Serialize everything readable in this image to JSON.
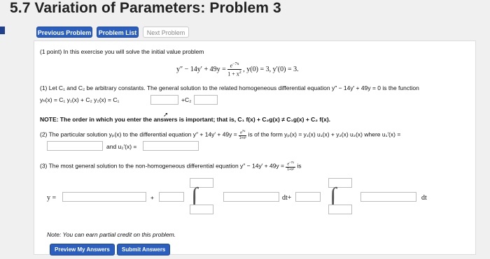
{
  "page": {
    "title": "5.7 Variation of Parameters: Problem 3"
  },
  "nav": {
    "previous": "Previous Problem",
    "list": "Problem List",
    "next": "Next Problem"
  },
  "intro": "(1 point) In this exercise you will solve the initial value problem",
  "ivp": {
    "lhs": "y″ − 14y′ + 49y =",
    "num": "e",
    "num_exp": "−7x",
    "den": "1 + x",
    "den_exp": "2",
    "ics": ",  y(0) = 3,  y′(0) = 3."
  },
  "part1": {
    "line1": "(1) Let C₁ and C₂ be arbitrary constants. The general solution to the related homogeneous differential equation y″ − 14y′ + 49y = 0 is the function",
    "line2_prefix": "yₕ(x) = C₁ y₁(x) + C₂ y₂(x) = C₁",
    "plus_c2": "+C₂"
  },
  "note_order": "NOTE: The order in which you enter the answers is important; that is, C₁ f(x) + C₂g(x) ≠ C₁g(x) + C₂ f(x).",
  "part2": {
    "line1_a": "(2) The particular solution yₚ(x) to the differential equation y″ + 14y′ + 49y =",
    "frac_num": "e",
    "frac_num_exp": "7x",
    "frac_den": "1+x²",
    "line1_b": "is of the form yₚ(x) = y₁(x) u₁(x) + y₂(x) u₂(x) where u₁′(x) =",
    "and_u2": "and u₂′(x) ="
  },
  "part3": {
    "line1": "(3) The most general solution to the non-homogeneous differential equation y″ − 14y′ + 49y =",
    "frac_num": "e",
    "frac_num_exp": "−7x",
    "frac_den": "1+x²",
    "is": "is",
    "y_eq": "y =",
    "plus": "+",
    "dt_plus": "dt+",
    "dt": "dt"
  },
  "note_credit": "Note: You can earn partial credit on this problem.",
  "buttons": {
    "preview": "Preview My Answers",
    "submit": "Submit Answers"
  }
}
